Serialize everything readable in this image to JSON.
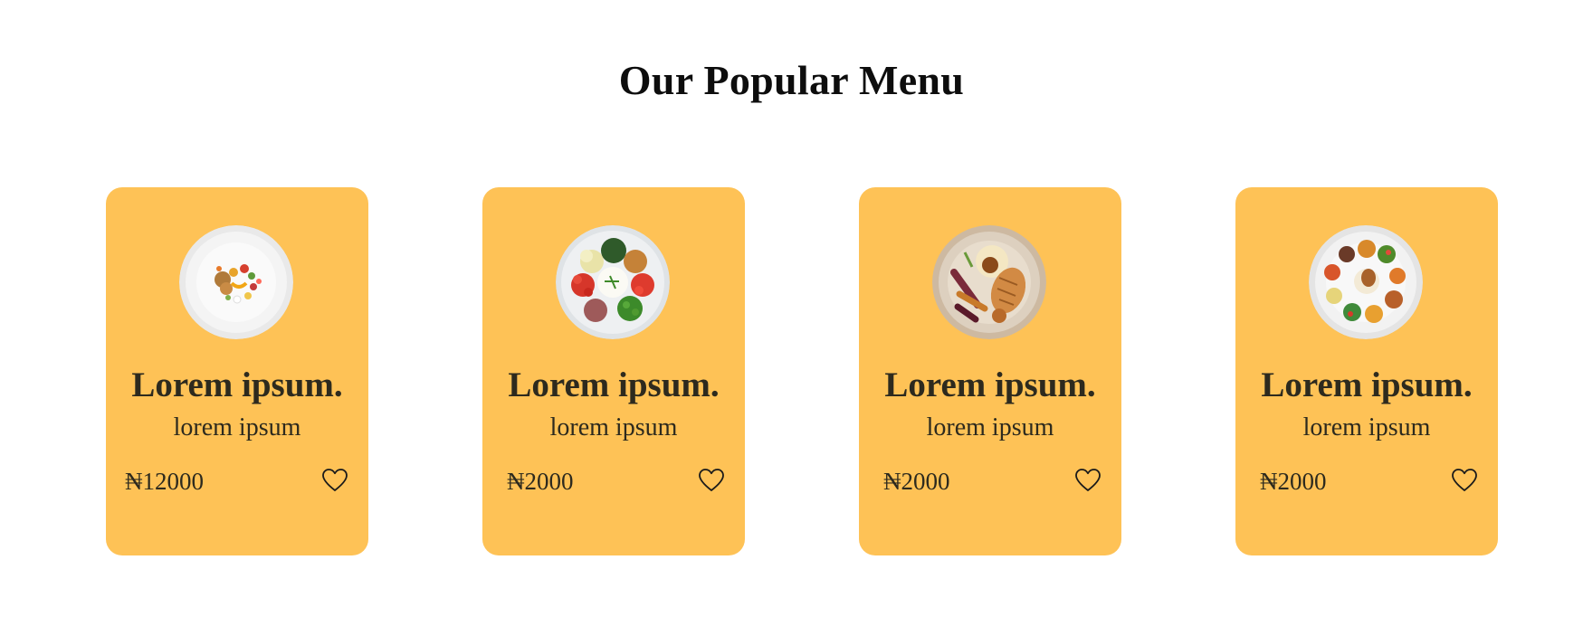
{
  "section": {
    "title": "Our Popular Menu"
  },
  "colors": {
    "card_background": "#fec256",
    "title_text": "#0d0d0d",
    "card_text": "#2d2a1e",
    "page_background": "#ffffff"
  },
  "menu_items": [
    {
      "title": "Lorem ipsum.",
      "subtitle": "lorem ipsum",
      "price": "₦12000",
      "image": "plated-dish-ring-garnish",
      "favorite_icon": "heart-outline-icon"
    },
    {
      "title": "Lorem ipsum.",
      "subtitle": "lorem ipsum",
      "price": "₦2000",
      "image": "rice-vegetable-platter",
      "favorite_icon": "heart-outline-icon"
    },
    {
      "title": "Lorem ipsum.",
      "subtitle": "lorem ipsum",
      "price": "₦2000",
      "image": "chicken-mash-roast-veg",
      "favorite_icon": "heart-outline-icon"
    },
    {
      "title": "Lorem ipsum.",
      "subtitle": "lorem ipsum",
      "price": "₦2000",
      "image": "mixed-appetizer-plate",
      "favorite_icon": "heart-outline-icon"
    }
  ]
}
